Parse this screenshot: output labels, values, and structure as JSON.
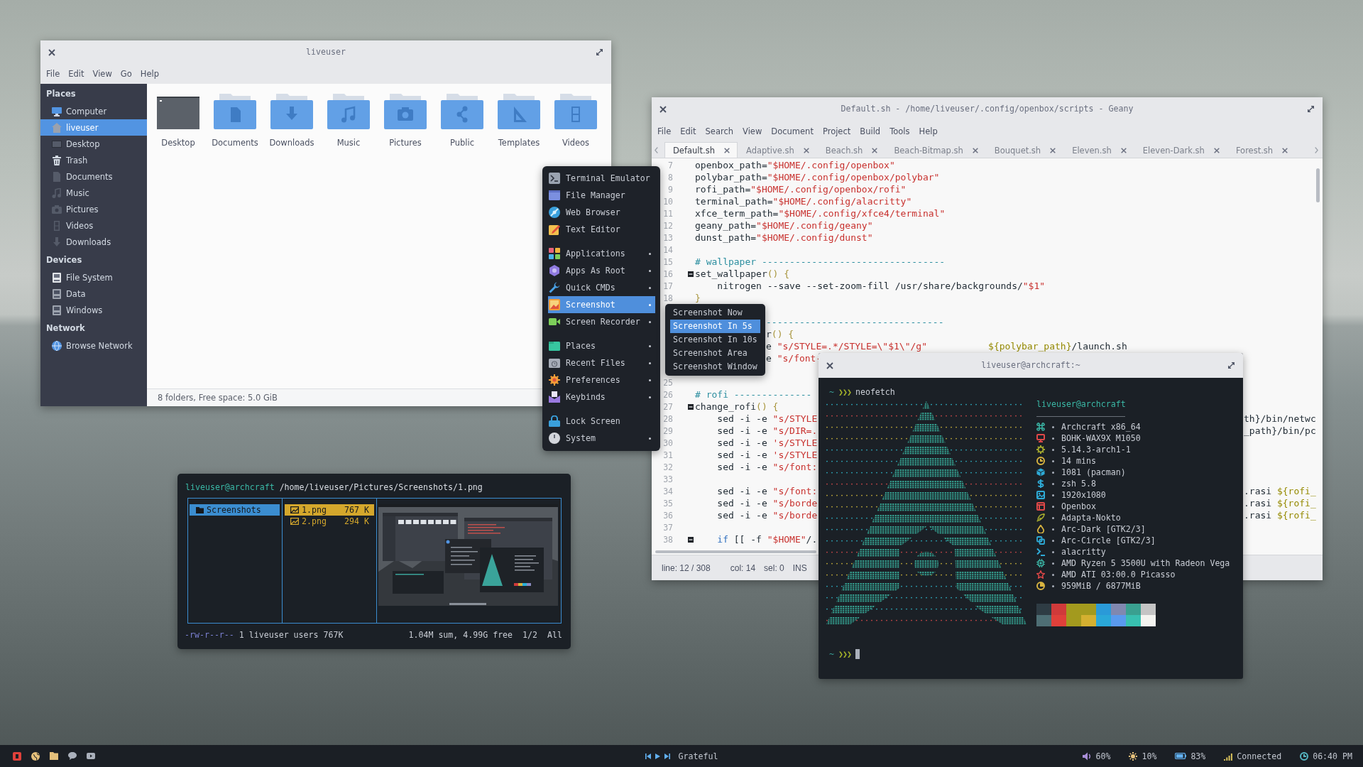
{
  "file_manager": {
    "title": "liveuser",
    "menu": [
      "File",
      "Edit",
      "View",
      "Go",
      "Help"
    ],
    "sidebar": [
      {
        "heading": "Places",
        "items": [
          {
            "label": "Computer",
            "selected": false
          },
          {
            "label": "liveuser",
            "selected": true
          },
          {
            "label": "Desktop",
            "selected": false
          },
          {
            "label": "Trash",
            "selected": false
          },
          {
            "label": "Documents",
            "selected": false
          },
          {
            "label": "Music",
            "selected": false
          },
          {
            "label": "Pictures",
            "selected": false
          },
          {
            "label": "Videos",
            "selected": false
          },
          {
            "label": "Downloads",
            "selected": false
          }
        ]
      },
      {
        "heading": "Devices",
        "items": [
          {
            "label": "File System",
            "selected": false
          },
          {
            "label": "Data",
            "selected": false
          },
          {
            "label": "Windows",
            "selected": false
          }
        ]
      },
      {
        "heading": "Network",
        "items": [
          {
            "label": "Browse Network",
            "selected": false
          }
        ]
      }
    ],
    "folders": [
      "Desktop",
      "Documents",
      "Downloads",
      "Music",
      "Pictures",
      "Public",
      "Templates",
      "Videos"
    ],
    "status": "8 folders, Free space: 5.0 GiB"
  },
  "geany": {
    "title": "Default.sh - /home/liveuser/.config/openbox/scripts - Geany",
    "menu": [
      "File",
      "Edit",
      "Search",
      "View",
      "Document",
      "Project",
      "Build",
      "Tools",
      "Help"
    ],
    "tabs": [
      {
        "label": "Default.sh",
        "selected": true
      },
      {
        "label": "Adaptive.sh",
        "selected": false
      },
      {
        "label": "Beach.sh",
        "selected": false
      },
      {
        "label": "Beach-Bitmap.sh",
        "selected": false
      },
      {
        "label": "Bouquet.sh",
        "selected": false
      },
      {
        "label": "Eleven.sh",
        "selected": false
      },
      {
        "label": "Eleven-Dark.sh",
        "selected": false
      },
      {
        "label": "Forest.sh",
        "selected": false
      }
    ],
    "lines": [
      {
        "number": "7",
        "fold": false,
        "code": [
          {
            "kind": "plain",
            "text": "openbox_path="
          },
          {
            "kind": "string",
            "text": "\"$HOME/.config/openbox\""
          }
        ]
      },
      {
        "number": "8",
        "fold": false,
        "code": [
          {
            "kind": "plain",
            "text": "polybar_path="
          },
          {
            "kind": "string",
            "text": "\"$HOME/.config/openbox/polybar\""
          }
        ]
      },
      {
        "number": "9",
        "fold": false,
        "code": [
          {
            "kind": "plain",
            "text": "rofi_path="
          },
          {
            "kind": "string",
            "text": "\"$HOME/.config/openbox/rofi\""
          }
        ]
      },
      {
        "number": "10",
        "fold": false,
        "code": [
          {
            "kind": "plain",
            "text": "terminal_path="
          },
          {
            "kind": "string",
            "text": "\"$HOME/.config/alacritty\""
          }
        ]
      },
      {
        "number": "11",
        "fold": false,
        "code": [
          {
            "kind": "plain",
            "text": "xfce_term_path="
          },
          {
            "kind": "string",
            "text": "\"$HOME/.config/xfce4/terminal\""
          }
        ]
      },
      {
        "number": "12",
        "fold": false,
        "code": [
          {
            "kind": "plain",
            "text": "geany_path="
          },
          {
            "kind": "string",
            "text": "\"$HOME/.config/geany\""
          }
        ]
      },
      {
        "number": "13",
        "fold": false,
        "code": [
          {
            "kind": "plain",
            "text": "dunst_path="
          },
          {
            "kind": "string",
            "text": "\"$HOME/.config/dunst\""
          }
        ]
      },
      {
        "number": "14",
        "fold": false
      },
      {
        "number": "15",
        "fold": false,
        "code": [
          {
            "kind": "comment",
            "text": "# wallpaper ---------------------------------"
          }
        ]
      },
      {
        "number": "16",
        "fold": true,
        "code": [
          {
            "kind": "plain",
            "text": "set_wallpaper"
          },
          {
            "kind": "brace",
            "text": "() {"
          }
        ]
      },
      {
        "number": "17",
        "fold": false,
        "code": [
          {
            "kind": "plain",
            "text": "    nitrogen --save --set-zoom-fill /usr/share/backgrounds/"
          },
          {
            "kind": "string",
            "text": "\"$1\""
          }
        ]
      },
      {
        "number": "18",
        "fold": false,
        "code": [
          {
            "kind": "brace",
            "text": "}"
          }
        ]
      },
      {
        "fold": false
      },
      {
        "fold": false,
        "past_menu": [
          {
            "kind": "comment",
            "text": "--------------------------------"
          }
        ]
      },
      {
        "fold": false,
        "past_menu": [
          {
            "kind": "plain",
            "text": "r"
          },
          {
            "kind": "brace",
            "text": "() {"
          }
        ]
      },
      {
        "fold": false,
        "past_menu": [
          {
            "kind": "plain",
            "text": "e "
          },
          {
            "kind": "string",
            "text": "\"s/STYLE=.*/STYLE=\\\"$1\\\"/g\""
          },
          {
            "kind": "variable",
            "text": "           ${polybar_path}"
          },
          {
            "kind": "plain",
            "text": "/launch.sh"
          }
        ]
      },
      {
        "fold": false,
        "past_menu": [
          {
            "kind": "plain",
            "text": "e "
          },
          {
            "kind": "string",
            "text": "\"s/font-"
          }
        ]
      },
      {
        "fold": false
      },
      {
        "number": "25",
        "fold": false
      },
      {
        "number": "26",
        "fold": false,
        "code": [
          {
            "kind": "comment",
            "text": "# rofi --------------"
          }
        ]
      },
      {
        "number": "27",
        "fold": true,
        "code": [
          {
            "kind": "plain",
            "text": "change_rofi"
          },
          {
            "kind": "brace",
            "text": "() {"
          }
        ]
      },
      {
        "number": "28",
        "fold": false,
        "code": [
          {
            "kind": "plain",
            "text": "    sed -i -e "
          },
          {
            "kind": "string",
            "text": "\"s/STYLE"
          }
        ],
        "past_terminal": [
          {
            "kind": "plain",
            "text": "th}/bin/netwc"
          }
        ]
      },
      {
        "number": "29",
        "fold": false,
        "code": [
          {
            "kind": "plain",
            "text": "    sed -i -e "
          },
          {
            "kind": "string",
            "text": "\"s/DIR=."
          }
        ],
        "past_terminal": [
          {
            "kind": "plain",
            "text": "_path}/bin/pc"
          }
        ]
      },
      {
        "number": "30",
        "fold": false,
        "code": [
          {
            "kind": "plain",
            "text": "    sed -i -e "
          },
          {
            "kind": "string",
            "text": "'s/STYLE"
          }
        ]
      },
      {
        "number": "31",
        "fold": false,
        "code": [
          {
            "kind": "plain",
            "text": "    sed -i -e "
          },
          {
            "kind": "string",
            "text": "'s/STYLE"
          }
        ]
      },
      {
        "number": "32",
        "fold": false,
        "code": [
          {
            "kind": "plain",
            "text": "    sed -i -e "
          },
          {
            "kind": "string",
            "text": "\"s/font:"
          }
        ]
      },
      {
        "number": "33",
        "fold": false
      },
      {
        "number": "34",
        "fold": false,
        "code": [
          {
            "kind": "plain",
            "text": "    sed -i -e "
          },
          {
            "kind": "string",
            "text": "\"s/font:"
          }
        ],
        "past_terminal": [
          {
            "kind": "plain",
            "text": ".rasi "
          },
          {
            "kind": "variable",
            "text": "${rofi_"
          }
        ]
      },
      {
        "number": "35",
        "fold": false,
        "code": [
          {
            "kind": "plain",
            "text": "    sed -i -e "
          },
          {
            "kind": "string",
            "text": "\"s/borde"
          }
        ],
        "past_terminal": [
          {
            "kind": "plain",
            "text": ".rasi "
          },
          {
            "kind": "variable",
            "text": "${rofi_"
          }
        ]
      },
      {
        "number": "36",
        "fold": false,
        "code": [
          {
            "kind": "plain",
            "text": "    sed -i -e "
          },
          {
            "kind": "string",
            "text": "\"s/borde"
          }
        ],
        "past_terminal": [
          {
            "kind": "plain",
            "text": ".rasi "
          },
          {
            "kind": "variable",
            "text": "${rofi_"
          }
        ]
      },
      {
        "number": "37",
        "fold": false
      },
      {
        "number": "38",
        "fold": true,
        "code": [
          {
            "kind": "keyword",
            "text": "    if"
          },
          {
            "kind": "plain",
            "text": " [[ -f "
          },
          {
            "kind": "string",
            "text": "\"$HOME\""
          },
          {
            "kind": "plain",
            "text": "/."
          }
        ]
      }
    ],
    "status": [
      "line: 12 / 308",
      "col: 14",
      "sel: 0",
      "INS"
    ]
  },
  "menu": {
    "groups": [
      [
        {
          "label": "Terminal Emulator",
          "submenu": false,
          "selected": false
        },
        {
          "label": "File Manager",
          "submenu": false,
          "selected": false
        },
        {
          "label": "Web Browser",
          "submenu": false,
          "selected": false
        },
        {
          "label": "Text Editor",
          "submenu": false,
          "selected": false
        }
      ],
      [
        {
          "label": "Applications",
          "submenu": true,
          "selected": false
        },
        {
          "label": "Apps As Root",
          "submenu": true,
          "selected": false
        },
        {
          "label": "Quick CMDs",
          "submenu": true,
          "selected": false
        },
        {
          "label": "Screenshot",
          "submenu": true,
          "selected": true
        },
        {
          "label": "Screen Recorder",
          "submenu": true,
          "selected": false
        }
      ],
      [
        {
          "label": "Places",
          "submenu": true,
          "selected": false
        },
        {
          "label": "Recent Files",
          "submenu": true,
          "selected": false
        },
        {
          "label": "Preferences",
          "submenu": true,
          "selected": false
        },
        {
          "label": "Keybinds",
          "submenu": true,
          "selected": false
        }
      ],
      [
        {
          "label": "Lock Screen",
          "submenu": false,
          "selected": false
        },
        {
          "label": "System",
          "submenu": true,
          "selected": false
        }
      ]
    ]
  },
  "submenu": {
    "items": [
      {
        "label": "Screenshot Now",
        "selected": false
      },
      {
        "label": "Screenshot In 5s",
        "selected": true
      },
      {
        "label": "Screenshot In 10s",
        "selected": false
      },
      {
        "label": "Screenshot Area",
        "selected": false
      },
      {
        "label": "Screenshot Window",
        "selected": false
      }
    ]
  },
  "terminal": {
    "title": "liveuser@archcraft:~",
    "prompt": {
      "path": "~",
      "symbol": "❯❯❯",
      "command": "neofetch"
    },
    "user_host": "liveuser@archcraft",
    "info": [
      {
        "color": "#3bb5a5",
        "value": "Archcraft x86_64"
      },
      {
        "color": "#e04848",
        "value": "BOHK-WAX9X M1050"
      },
      {
        "color": "#a3a82e",
        "value": "5.14.3-arch1-1"
      },
      {
        "color": "#d8b440",
        "value": "14 mins"
      },
      {
        "color": "#2eaad6",
        "value": "1081 (pacman)"
      },
      {
        "color": "#2eaad6",
        "value": "zsh 5.8"
      },
      {
        "color": "#2eaad6",
        "value": "1920x1080"
      },
      {
        "color": "#e04848",
        "value": "Openbox"
      },
      {
        "color": "#a3a82e",
        "value": "Adapta-Nokto"
      },
      {
        "color": "#d8b440",
        "value": "Arc-Dark [GTK2/3]"
      },
      {
        "color": "#2eaad6",
        "value": "Arc-Circle [GTK2/3]"
      },
      {
        "color": "#2eaad6",
        "value": "alacritty"
      },
      {
        "color": "#3bb5a5",
        "value": "AMD Ryzen 5 3500U with Radeon Vega"
      },
      {
        "color": "#e04848",
        "value": "AMD ATI 03:00.0 Picasso"
      },
      {
        "color": "#d8b440",
        "value": "959MiB / 6877MiB"
      }
    ],
    "palette": [
      {
        "color": "#2e3c44"
      },
      {
        "color": "#d03a3a"
      },
      {
        "color": "#a39a1e"
      },
      {
        "color": "#a39a1e"
      },
      {
        "color": "#2a9ad8"
      },
      {
        "color": "#8088b0"
      },
      {
        "color": "#3aa090"
      },
      {
        "color": "#c4c4c4"
      },
      {
        "color": "#4e6e74"
      },
      {
        "color": "#e0403a"
      },
      {
        "color": "#a39a1e"
      },
      {
        "color": "#d4b030"
      },
      {
        "color": "#2aa8d8"
      },
      {
        "color": "#5a9aee"
      },
      {
        "color": "#38c0b0"
      },
      {
        "color": "#f4f4f0"
      }
    ],
    "next_prompt": {
      "path": "~",
      "symbol": "❯❯❯"
    }
  },
  "ranger": {
    "user_host": "liveuser@archcraft",
    "path": "/home/liveuser/Pictures/Screenshots/1.png",
    "directories": [
      {
        "name": "Screenshots",
        "selected": true
      }
    ],
    "files": [
      {
        "name": "1.png",
        "size": "767 K",
        "selected": true
      },
      {
        "name": "2.png",
        "size": "294 K",
        "selected": false
      }
    ],
    "permissions": "-rw-r--r--",
    "file_info": "1 liveuser users 767K",
    "disk_info": "1.04M sum, 4.99G free",
    "position": "1/2",
    "scroll": "All"
  },
  "taskbar": {
    "track": "Grateful",
    "indicators": [
      {
        "text": "60%",
        "color": "#a98ed8"
      },
      {
        "text": "10%",
        "color": "#e5c07b"
      },
      {
        "text": "83%",
        "color": "#61afef"
      },
      {
        "text": "Connected",
        "color": "#d7c05a"
      },
      {
        "text": "06:40 PM",
        "color": "#56b6c2"
      }
    ]
  }
}
